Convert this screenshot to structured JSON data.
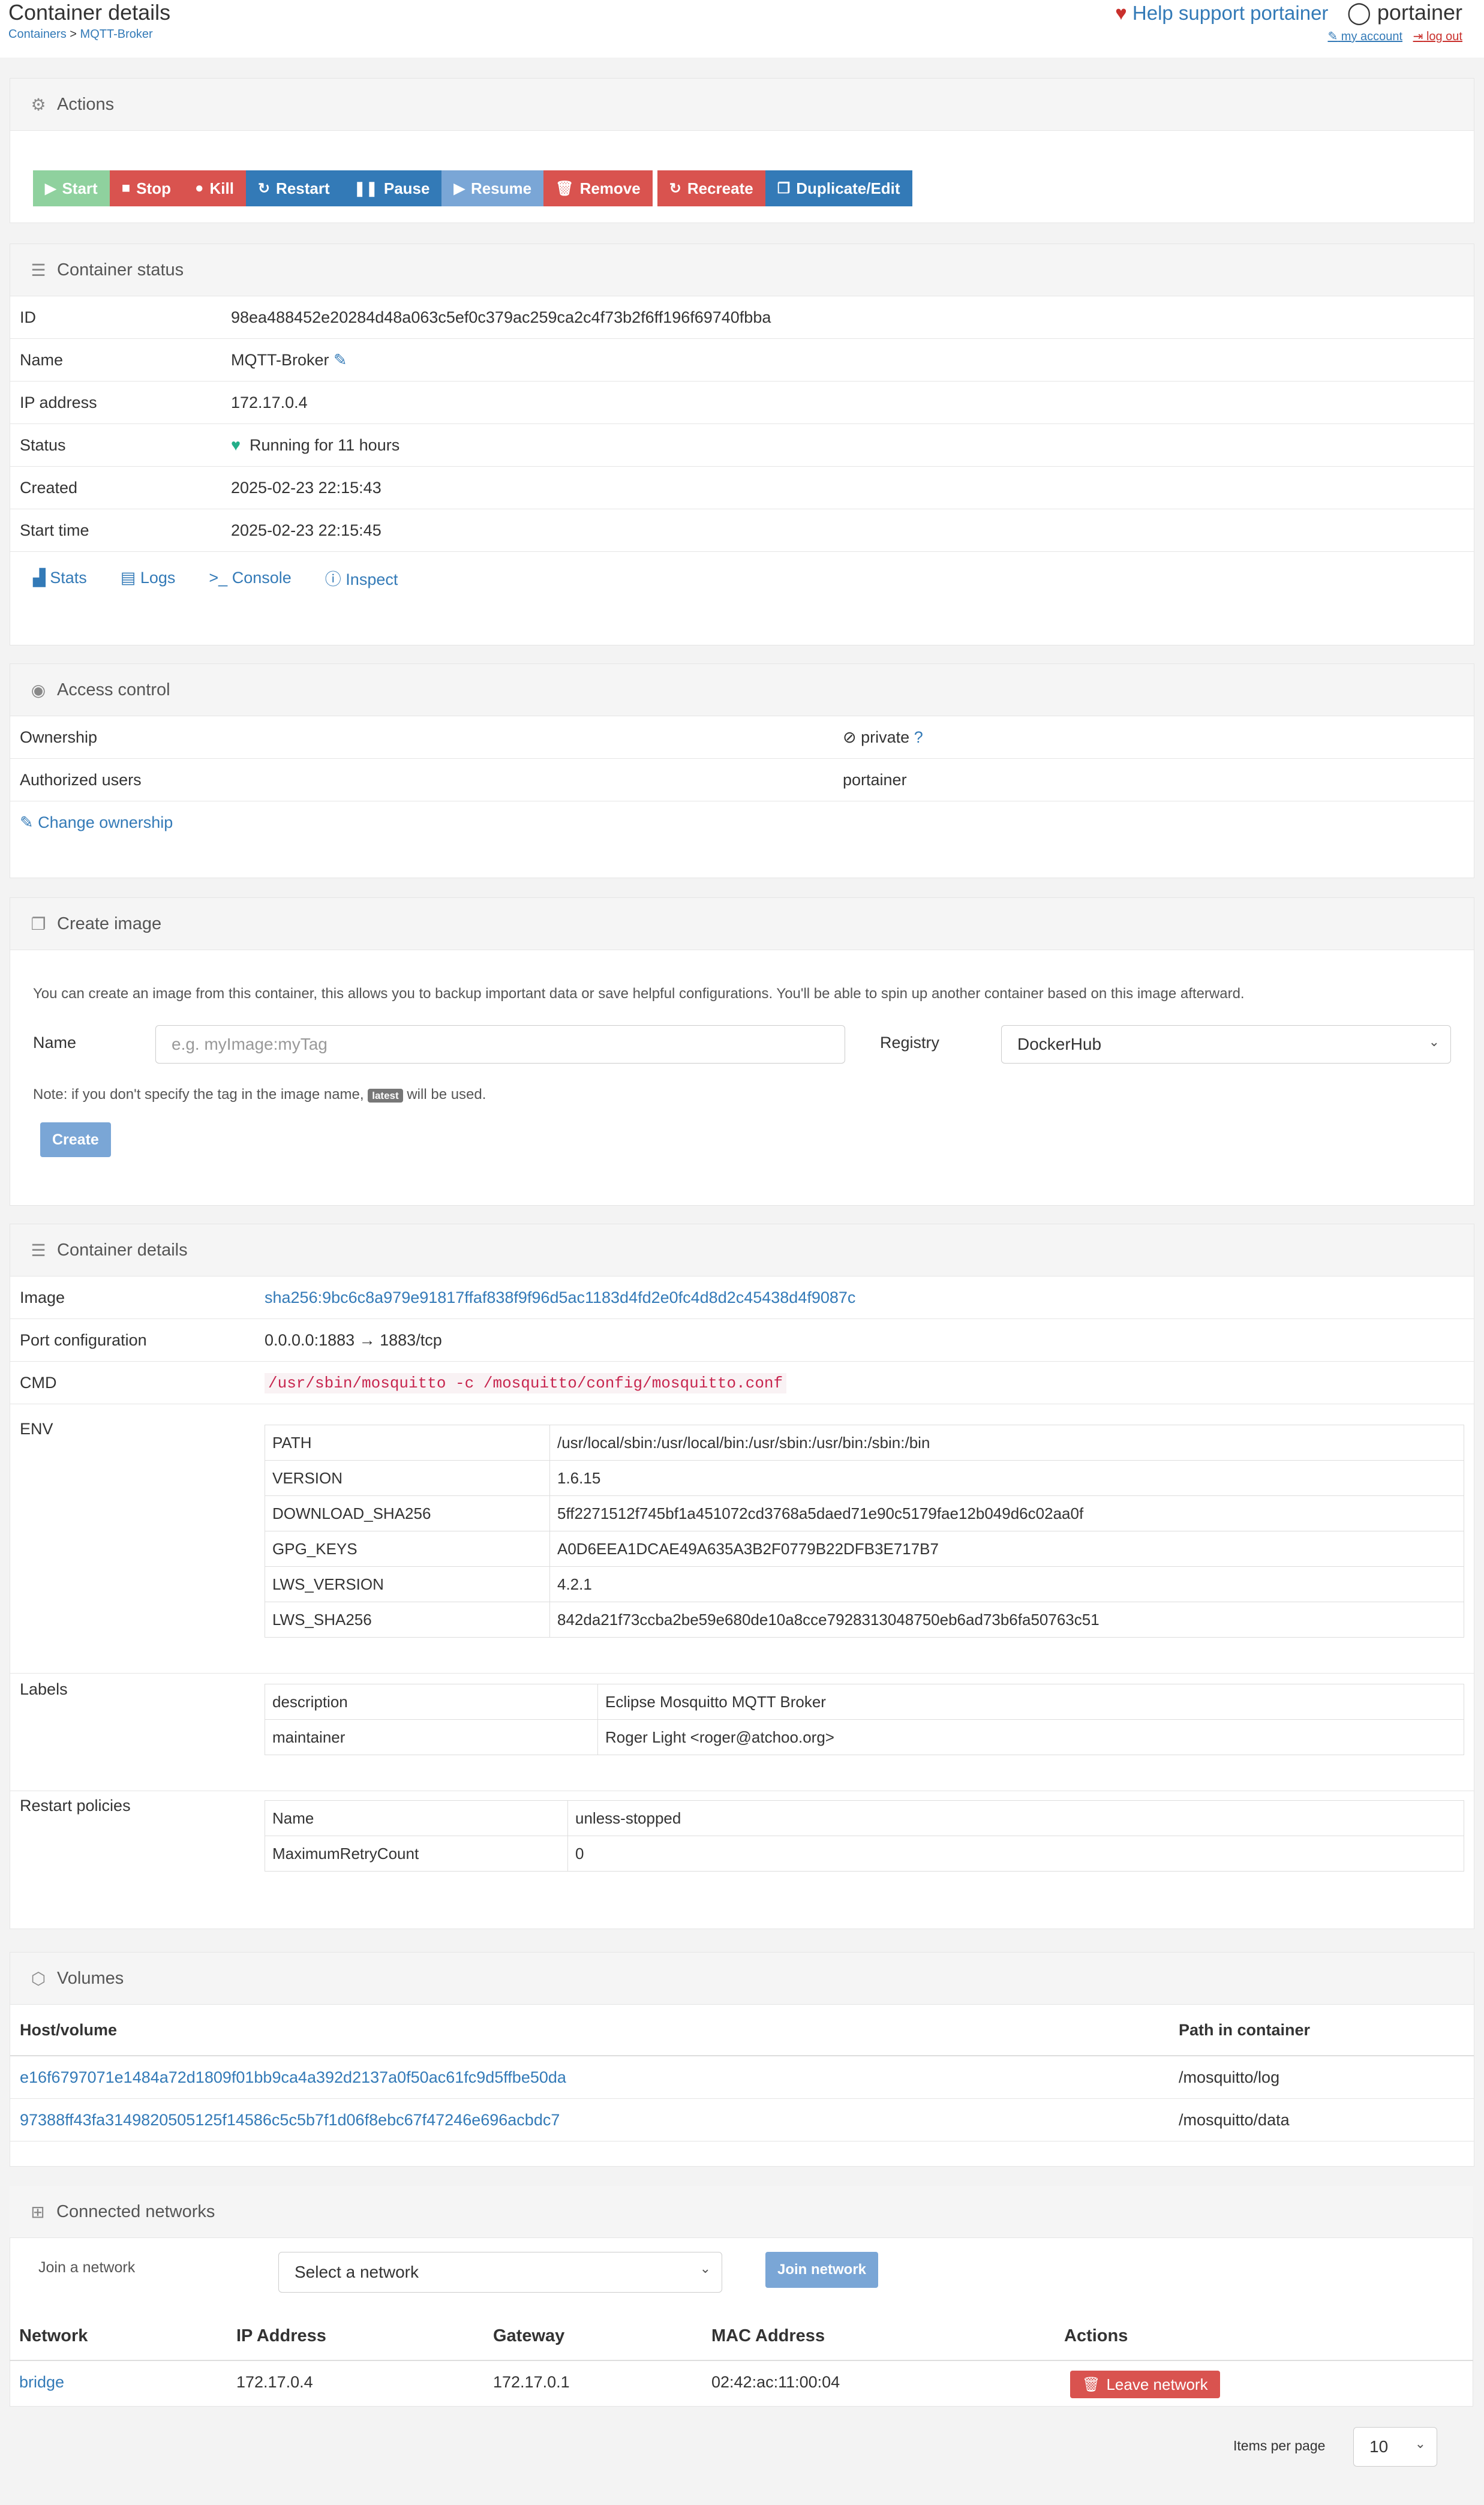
{
  "header": {
    "title": "Container details",
    "breadcrumb_root": "Containers",
    "breadcrumb_sep": ">",
    "breadcrumb_current": "MQTT-Broker",
    "support": "Help support portainer",
    "user": "portainer",
    "my_account": "my account",
    "log_out": "log out"
  },
  "actions": {
    "title": "Actions",
    "buttons": [
      "Start",
      "Stop",
      "Kill",
      "Restart",
      "Pause",
      "Resume",
      "Remove",
      "Recreate",
      "Duplicate/Edit"
    ]
  },
  "status": {
    "title": "Container status",
    "rows": [
      {
        "k": "ID",
        "v": "98ea488452e20284d48a063c5ef0c379ac259ca2c4f73b2f6ff196f69740fbba"
      },
      {
        "k": "Name",
        "v": "MQTT-Broker"
      },
      {
        "k": "IP address",
        "v": "172.17.0.4"
      },
      {
        "k": "Status",
        "v": "Running for 11 hours"
      },
      {
        "k": "Created",
        "v": "2025-02-23 22:15:43"
      },
      {
        "k": "Start time",
        "v": "2025-02-23 22:15:45"
      }
    ],
    "links": [
      "Stats",
      "Logs",
      "Console",
      "Inspect"
    ]
  },
  "access": {
    "title": "Access control",
    "ownership_label": "Ownership",
    "ownership_value": "private",
    "users_label": "Authorized users",
    "users_value": "portainer",
    "change": "Change ownership"
  },
  "create_image": {
    "title": "Create image",
    "description": "You can create an image from this container, this allows you to backup important data or save helpful configurations. You'll be able to spin up another container based on this image afterward.",
    "name_label": "Name",
    "name_placeholder": "e.g. myImage:myTag",
    "registry_label": "Registry",
    "registry_value": "DockerHub",
    "note_before": "Note: if you don't specify the tag in the image name,",
    "note_badge": "latest",
    "note_after": "will be used.",
    "create_button": "Create"
  },
  "details": {
    "title": "Container details",
    "image_label": "Image",
    "image_value": "sha256:9bc6c8a979e91817ffaf838f9f96d5ac1183d4fd2e0fc4d8d2c45438d4f9087c",
    "port_label": "Port configuration",
    "port_value": "0.0.0.0:1883 → 1883/tcp",
    "cmd_label": "CMD",
    "cmd_value": "/usr/sbin/mosquitto -c /mosquitto/config/mosquitto.conf",
    "env_label": "ENV",
    "env": [
      {
        "k": "PATH",
        "v": "/usr/local/sbin:/usr/local/bin:/usr/sbin:/usr/bin:/sbin:/bin"
      },
      {
        "k": "VERSION",
        "v": "1.6.15"
      },
      {
        "k": "DOWNLOAD_SHA256",
        "v": "5ff2271512f745bf1a451072cd3768a5daed71e90c5179fae12b049d6c02aa0f"
      },
      {
        "k": "GPG_KEYS",
        "v": "A0D6EEA1DCAE49A635A3B2F0779B22DFB3E717B7"
      },
      {
        "k": "LWS_VERSION",
        "v": "4.2.1"
      },
      {
        "k": "LWS_SHA256",
        "v": "842da21f73ccba2be59e680de10a8cce7928313048750eb6ad73b6fa50763c51"
      }
    ],
    "labels_label": "Labels",
    "labels": [
      {
        "k": "description",
        "v": "Eclipse Mosquitto MQTT Broker"
      },
      {
        "k": "maintainer",
        "v": "Roger Light <roger@atchoo.org>"
      }
    ],
    "restart_label": "Restart policies",
    "restart": [
      {
        "k": "Name",
        "v": "unless-stopped"
      },
      {
        "k": "MaximumRetryCount",
        "v": "0"
      }
    ]
  },
  "volumes": {
    "title": "Volumes",
    "col_host": "Host/volume",
    "col_path": "Path in container",
    "rows": [
      {
        "host": "e16f6797071e1484a72d1809f01bb9ca4a392d2137a0f50ac61fc9d5ffbe50da",
        "path": "/mosquitto/log"
      },
      {
        "host": "97388ff43fa3149820505125f14586c5c5b7f1d06f8ebc67f47246e696acbdc7",
        "path": "/mosquitto/data"
      }
    ]
  },
  "networks": {
    "title": "Connected networks",
    "join_label": "Join a network",
    "select_placeholder": "Select a network",
    "join_button": "Join network",
    "cols": [
      "Network",
      "IP Address",
      "Gateway",
      "MAC Address",
      "Actions"
    ],
    "row": {
      "network": "bridge",
      "ip": "172.17.0.4",
      "gateway": "172.17.0.1",
      "mac": "02:42:ac:11:00:04",
      "action": "Leave network"
    },
    "items_per_page_label": "Items per page",
    "items_per_page_value": "10"
  }
}
